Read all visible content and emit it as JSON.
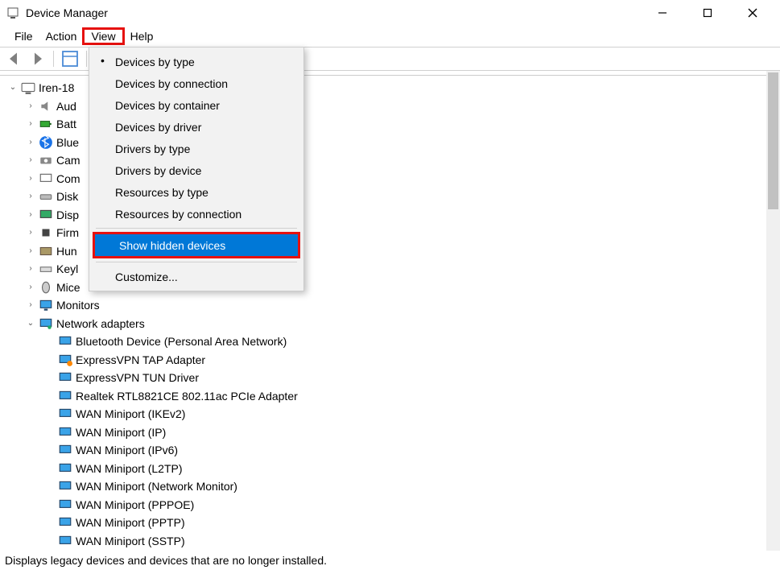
{
  "window": {
    "title": "Device Manager"
  },
  "menubar": {
    "file": "File",
    "action": "Action",
    "view": "View",
    "help": "Help"
  },
  "viewMenu": {
    "items": [
      "Devices by type",
      "Devices by connection",
      "Devices by container",
      "Devices by driver",
      "Drivers by type",
      "Drivers by device",
      "Resources by type",
      "Resources by connection"
    ],
    "showHidden": "Show hidden devices",
    "customize": "Customize..."
  },
  "tree": {
    "root": "Iren-18",
    "categories": [
      "Aud",
      "Batt",
      "Blue",
      "Cam",
      "Com",
      "Disk",
      "Disp",
      "Firm",
      "Hun",
      "Keyl",
      "Mice",
      "Monitors",
      "Network adapters"
    ],
    "network_items": [
      "Bluetooth Device (Personal Area Network)",
      "ExpressVPN TAP Adapter",
      "ExpressVPN TUN Driver",
      "Realtek RTL8821CE 802.11ac PCIe Adapter",
      "WAN Miniport (IKEv2)",
      "WAN Miniport (IP)",
      "WAN Miniport (IPv6)",
      "WAN Miniport (L2TP)",
      "WAN Miniport (Network Monitor)",
      "WAN Miniport (PPPOE)",
      "WAN Miniport (PPTP)",
      "WAN Miniport (SSTP)"
    ]
  },
  "statusbar": "Displays legacy devices and devices that are no longer installed."
}
